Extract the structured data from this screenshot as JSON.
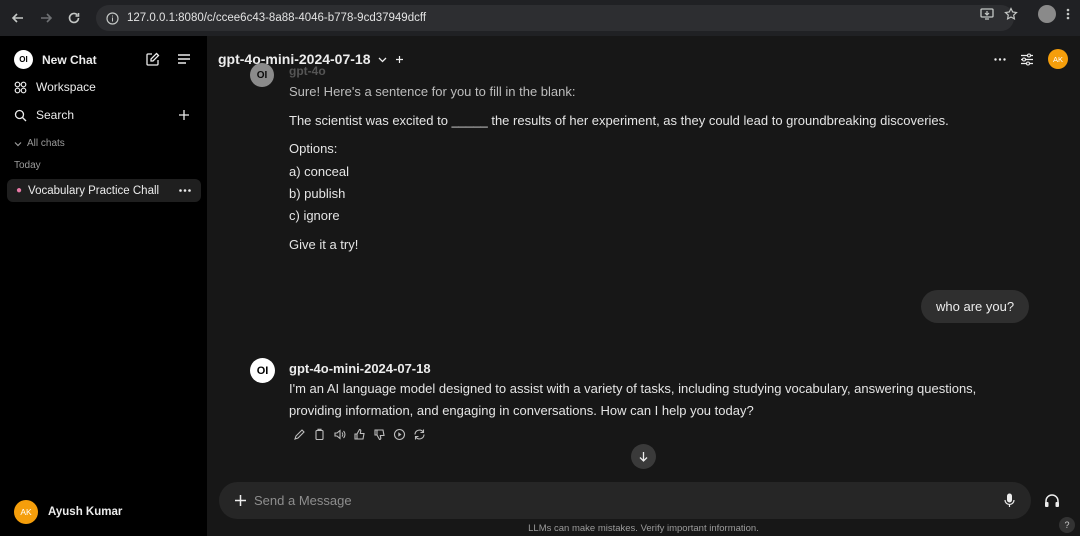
{
  "browser": {
    "url": "127.0.0.1:8080/c/ccee6c43-8a88-4046-b778-9cd37949dcff"
  },
  "sidebar": {
    "new_chat": "New Chat",
    "workspace": "Workspace",
    "search": "Search",
    "all_chats": "All chats",
    "group_today": "Today",
    "chat_item": "Vocabulary Practice Chall",
    "user_initials": "AK",
    "user_name": "Ayush Kumar"
  },
  "header": {
    "model": "gpt-4o-mini-2024-07-18",
    "avatar_initials": "AK"
  },
  "messages": {
    "prev_model": "gpt-4o",
    "lines": [
      "Sure! Here's a sentence for you to fill in the blank:",
      "The scientist was excited to _____ the results of her experiment, as they could lead to groundbreaking discoveries.",
      "Options:",
      "a) conceal",
      "b) publish",
      "c) ignore",
      "Give it a try!"
    ],
    "user_question": "who are you?",
    "reply_model": "gpt-4o-mini-2024-07-18",
    "reply_line1": "I'm an AI language model designed to assist with a variety of tasks, including studying vocabulary, answering questions,",
    "reply_line2": "providing information, and engaging in conversations. How can I help you today?"
  },
  "input": {
    "placeholder": "Send a Message"
  },
  "footer": {
    "disclaimer": "LLMs can make mistakes. Verify important information.",
    "help": "?"
  },
  "colors": {
    "accent": "#f59e0b",
    "sidebar_bg": "#000000",
    "main_bg": "#171717"
  }
}
